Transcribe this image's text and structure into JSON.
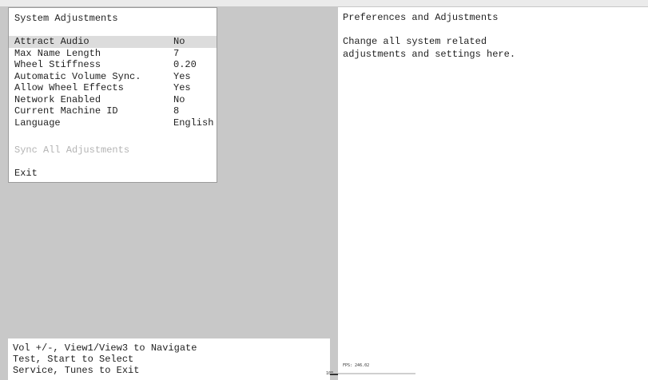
{
  "menu": {
    "title": "System Adjustments",
    "items": [
      {
        "label": "Attract Audio",
        "value": "No"
      },
      {
        "label": "Max Name Length",
        "value": "7"
      },
      {
        "label": "Wheel Stiffness",
        "value": "0.20"
      },
      {
        "label": "Automatic Volume Sync.",
        "value": "Yes"
      },
      {
        "label": "Allow Wheel Effects",
        "value": "Yes"
      },
      {
        "label": "Network Enabled",
        "value": "No"
      },
      {
        "label": "Current Machine ID",
        "value": "8"
      },
      {
        "label": "Language",
        "value": "English"
      }
    ],
    "sync_label": "Sync All Adjustments",
    "exit_label": "Exit"
  },
  "description": {
    "title": "Preferences and Adjustments",
    "line1": "Change all system related",
    "line2": "adjustments and settings here."
  },
  "help": {
    "line1": "Vol +/-, View1/View3 to Navigate",
    "line2": "Test, Start to Select",
    "line3": "Service, Tunes to Exit"
  },
  "perf": {
    "fps_label": "FPS: 246.02",
    "graph_tick": "100"
  },
  "colors": {
    "background": "#c8c8c8",
    "panel": "#ffffff",
    "selected_row": "#dcdcdc",
    "disabled_text": "#b4b4b4",
    "text": "#222222"
  }
}
